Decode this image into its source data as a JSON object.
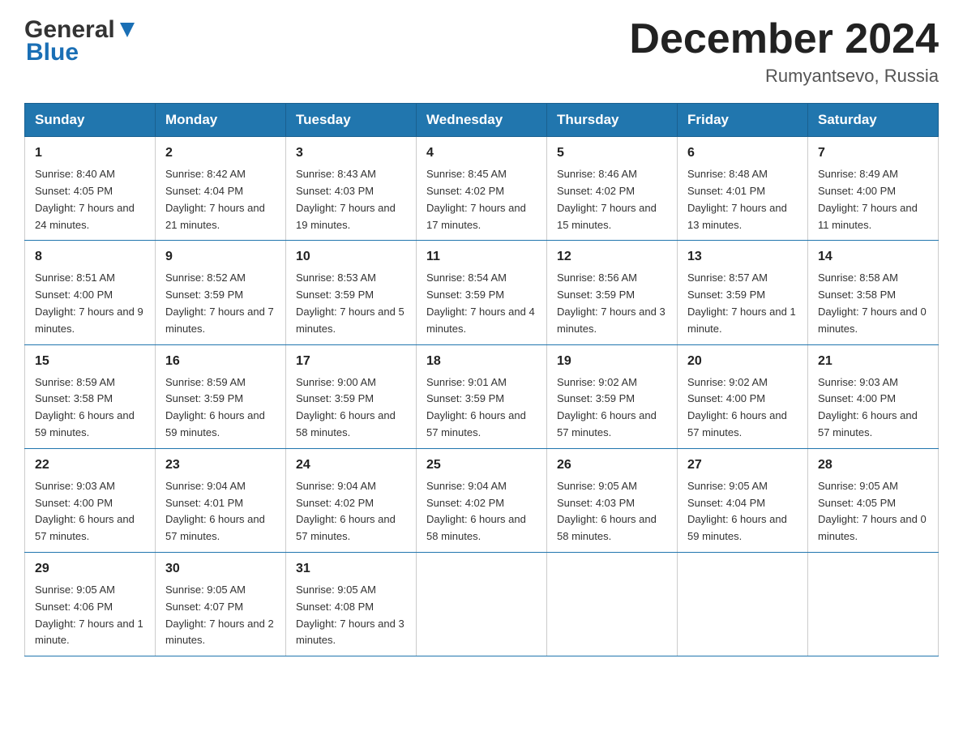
{
  "header": {
    "logo": {
      "general_text": "General",
      "blue_text": "Blue"
    },
    "title": "December 2024",
    "location": "Rumyantsevo, Russia"
  },
  "calendar": {
    "days_of_week": [
      "Sunday",
      "Monday",
      "Tuesday",
      "Wednesday",
      "Thursday",
      "Friday",
      "Saturday"
    ],
    "weeks": [
      [
        {
          "date": "1",
          "sunrise": "Sunrise: 8:40 AM",
          "sunset": "Sunset: 4:05 PM",
          "daylight": "Daylight: 7 hours and 24 minutes."
        },
        {
          "date": "2",
          "sunrise": "Sunrise: 8:42 AM",
          "sunset": "Sunset: 4:04 PM",
          "daylight": "Daylight: 7 hours and 21 minutes."
        },
        {
          "date": "3",
          "sunrise": "Sunrise: 8:43 AM",
          "sunset": "Sunset: 4:03 PM",
          "daylight": "Daylight: 7 hours and 19 minutes."
        },
        {
          "date": "4",
          "sunrise": "Sunrise: 8:45 AM",
          "sunset": "Sunset: 4:02 PM",
          "daylight": "Daylight: 7 hours and 17 minutes."
        },
        {
          "date": "5",
          "sunrise": "Sunrise: 8:46 AM",
          "sunset": "Sunset: 4:02 PM",
          "daylight": "Daylight: 7 hours and 15 minutes."
        },
        {
          "date": "6",
          "sunrise": "Sunrise: 8:48 AM",
          "sunset": "Sunset: 4:01 PM",
          "daylight": "Daylight: 7 hours and 13 minutes."
        },
        {
          "date": "7",
          "sunrise": "Sunrise: 8:49 AM",
          "sunset": "Sunset: 4:00 PM",
          "daylight": "Daylight: 7 hours and 11 minutes."
        }
      ],
      [
        {
          "date": "8",
          "sunrise": "Sunrise: 8:51 AM",
          "sunset": "Sunset: 4:00 PM",
          "daylight": "Daylight: 7 hours and 9 minutes."
        },
        {
          "date": "9",
          "sunrise": "Sunrise: 8:52 AM",
          "sunset": "Sunset: 3:59 PM",
          "daylight": "Daylight: 7 hours and 7 minutes."
        },
        {
          "date": "10",
          "sunrise": "Sunrise: 8:53 AM",
          "sunset": "Sunset: 3:59 PM",
          "daylight": "Daylight: 7 hours and 5 minutes."
        },
        {
          "date": "11",
          "sunrise": "Sunrise: 8:54 AM",
          "sunset": "Sunset: 3:59 PM",
          "daylight": "Daylight: 7 hours and 4 minutes."
        },
        {
          "date": "12",
          "sunrise": "Sunrise: 8:56 AM",
          "sunset": "Sunset: 3:59 PM",
          "daylight": "Daylight: 7 hours and 3 minutes."
        },
        {
          "date": "13",
          "sunrise": "Sunrise: 8:57 AM",
          "sunset": "Sunset: 3:59 PM",
          "daylight": "Daylight: 7 hours and 1 minute."
        },
        {
          "date": "14",
          "sunrise": "Sunrise: 8:58 AM",
          "sunset": "Sunset: 3:58 PM",
          "daylight": "Daylight: 7 hours and 0 minutes."
        }
      ],
      [
        {
          "date": "15",
          "sunrise": "Sunrise: 8:59 AM",
          "sunset": "Sunset: 3:58 PM",
          "daylight": "Daylight: 6 hours and 59 minutes."
        },
        {
          "date": "16",
          "sunrise": "Sunrise: 8:59 AM",
          "sunset": "Sunset: 3:59 PM",
          "daylight": "Daylight: 6 hours and 59 minutes."
        },
        {
          "date": "17",
          "sunrise": "Sunrise: 9:00 AM",
          "sunset": "Sunset: 3:59 PM",
          "daylight": "Daylight: 6 hours and 58 minutes."
        },
        {
          "date": "18",
          "sunrise": "Sunrise: 9:01 AM",
          "sunset": "Sunset: 3:59 PM",
          "daylight": "Daylight: 6 hours and 57 minutes."
        },
        {
          "date": "19",
          "sunrise": "Sunrise: 9:02 AM",
          "sunset": "Sunset: 3:59 PM",
          "daylight": "Daylight: 6 hours and 57 minutes."
        },
        {
          "date": "20",
          "sunrise": "Sunrise: 9:02 AM",
          "sunset": "Sunset: 4:00 PM",
          "daylight": "Daylight: 6 hours and 57 minutes."
        },
        {
          "date": "21",
          "sunrise": "Sunrise: 9:03 AM",
          "sunset": "Sunset: 4:00 PM",
          "daylight": "Daylight: 6 hours and 57 minutes."
        }
      ],
      [
        {
          "date": "22",
          "sunrise": "Sunrise: 9:03 AM",
          "sunset": "Sunset: 4:00 PM",
          "daylight": "Daylight: 6 hours and 57 minutes."
        },
        {
          "date": "23",
          "sunrise": "Sunrise: 9:04 AM",
          "sunset": "Sunset: 4:01 PM",
          "daylight": "Daylight: 6 hours and 57 minutes."
        },
        {
          "date": "24",
          "sunrise": "Sunrise: 9:04 AM",
          "sunset": "Sunset: 4:02 PM",
          "daylight": "Daylight: 6 hours and 57 minutes."
        },
        {
          "date": "25",
          "sunrise": "Sunrise: 9:04 AM",
          "sunset": "Sunset: 4:02 PM",
          "daylight": "Daylight: 6 hours and 58 minutes."
        },
        {
          "date": "26",
          "sunrise": "Sunrise: 9:05 AM",
          "sunset": "Sunset: 4:03 PM",
          "daylight": "Daylight: 6 hours and 58 minutes."
        },
        {
          "date": "27",
          "sunrise": "Sunrise: 9:05 AM",
          "sunset": "Sunset: 4:04 PM",
          "daylight": "Daylight: 6 hours and 59 minutes."
        },
        {
          "date": "28",
          "sunrise": "Sunrise: 9:05 AM",
          "sunset": "Sunset: 4:05 PM",
          "daylight": "Daylight: 7 hours and 0 minutes."
        }
      ],
      [
        {
          "date": "29",
          "sunrise": "Sunrise: 9:05 AM",
          "sunset": "Sunset: 4:06 PM",
          "daylight": "Daylight: 7 hours and 1 minute."
        },
        {
          "date": "30",
          "sunrise": "Sunrise: 9:05 AM",
          "sunset": "Sunset: 4:07 PM",
          "daylight": "Daylight: 7 hours and 2 minutes."
        },
        {
          "date": "31",
          "sunrise": "Sunrise: 9:05 AM",
          "sunset": "Sunset: 4:08 PM",
          "daylight": "Daylight: 7 hours and 3 minutes."
        },
        null,
        null,
        null,
        null
      ]
    ]
  }
}
